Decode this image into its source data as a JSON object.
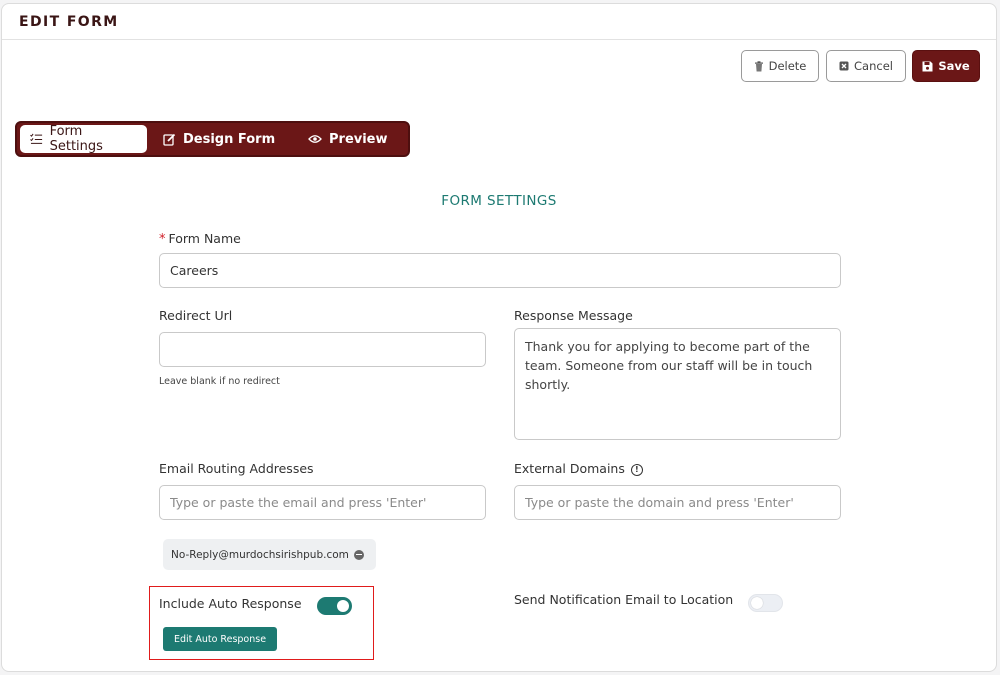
{
  "header": {
    "title": "EDIT FORM"
  },
  "actions": {
    "delete_label": "Delete",
    "cancel_label": "Cancel",
    "save_label": "Save"
  },
  "tabs": [
    {
      "label": "Form Settings",
      "icon": "list-check-icon",
      "active": true
    },
    {
      "label": "Design Form",
      "icon": "edit-icon",
      "active": false
    },
    {
      "label": "Preview",
      "icon": "eye-icon",
      "active": false
    }
  ],
  "section": {
    "title": "FORM SETTINGS"
  },
  "form": {
    "name": {
      "label": "Form Name",
      "required_mark": "*",
      "value": "Careers"
    },
    "redirect_url": {
      "label": "Redirect Url",
      "value": "",
      "hint": "Leave blank if no redirect"
    },
    "response_message": {
      "label": "Response Message",
      "value": "Thank you for applying to become part of the team. Someone from our staff will be in touch shortly."
    },
    "email_routing": {
      "label": "Email Routing Addresses",
      "placeholder": "Type or paste the email and press 'Enter'",
      "chips": [
        "No-Reply@murdochsirishpub.com"
      ]
    },
    "external_domains": {
      "label": "External Domains",
      "placeholder": "Type or paste the domain and press 'Enter'"
    },
    "auto_response": {
      "label": "Include Auto Response",
      "enabled": true,
      "edit_label": "Edit Auto Response"
    },
    "notify_location": {
      "label": "Send Notification Email to Location",
      "enabled": false
    }
  },
  "colors": {
    "brand": "#6b1717",
    "accent": "#1d7a72",
    "highlight": "#e01b1b"
  }
}
